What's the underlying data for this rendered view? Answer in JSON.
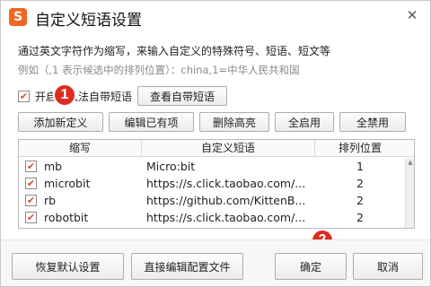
{
  "window": {
    "title": "自定义短语设置",
    "app_icon_letter": "S",
    "close_icon": "close-icon"
  },
  "description": {
    "line1": "通过英文字符作为缩写，来输入自定义的特殊符号、短语、短文等",
    "line2": "例如（,1 表示候选中的排列位置）：china,1=中华人民共和国"
  },
  "enable": {
    "checked": true,
    "label": "开启输入法自带短语",
    "view_button": "查看自带短语"
  },
  "toolbar": {
    "add": "添加新定义",
    "edit": "编辑已有项",
    "delete_highlight": "删除高亮",
    "enable_all": "全启用",
    "disable_all": "全禁用"
  },
  "table": {
    "columns": [
      "缩写",
      "自定义短语",
      "排列位置"
    ],
    "rows": [
      {
        "checked": true,
        "abbr": "mb",
        "phrase": "Micro:bit",
        "position": "1"
      },
      {
        "checked": true,
        "abbr": "microbit",
        "phrase": "https://s.click.taobao.com/...",
        "position": "2"
      },
      {
        "checked": true,
        "abbr": "rb",
        "phrase": "https://github.com/KittenB...",
        "position": "2"
      },
      {
        "checked": true,
        "abbr": "robotbit",
        "phrase": "https://s.click.taobao.com/...",
        "position": "2"
      }
    ]
  },
  "footer": {
    "restore_default": "恢复默认设置",
    "edit_config": "直接编辑配置文件",
    "ok": "确定",
    "cancel": "取消"
  },
  "annotations": {
    "badge1": "1",
    "badge2": "2",
    "badge_color": "#e02b20"
  },
  "colors": {
    "accent": "#f26522",
    "checkmark": "#e0492a"
  }
}
